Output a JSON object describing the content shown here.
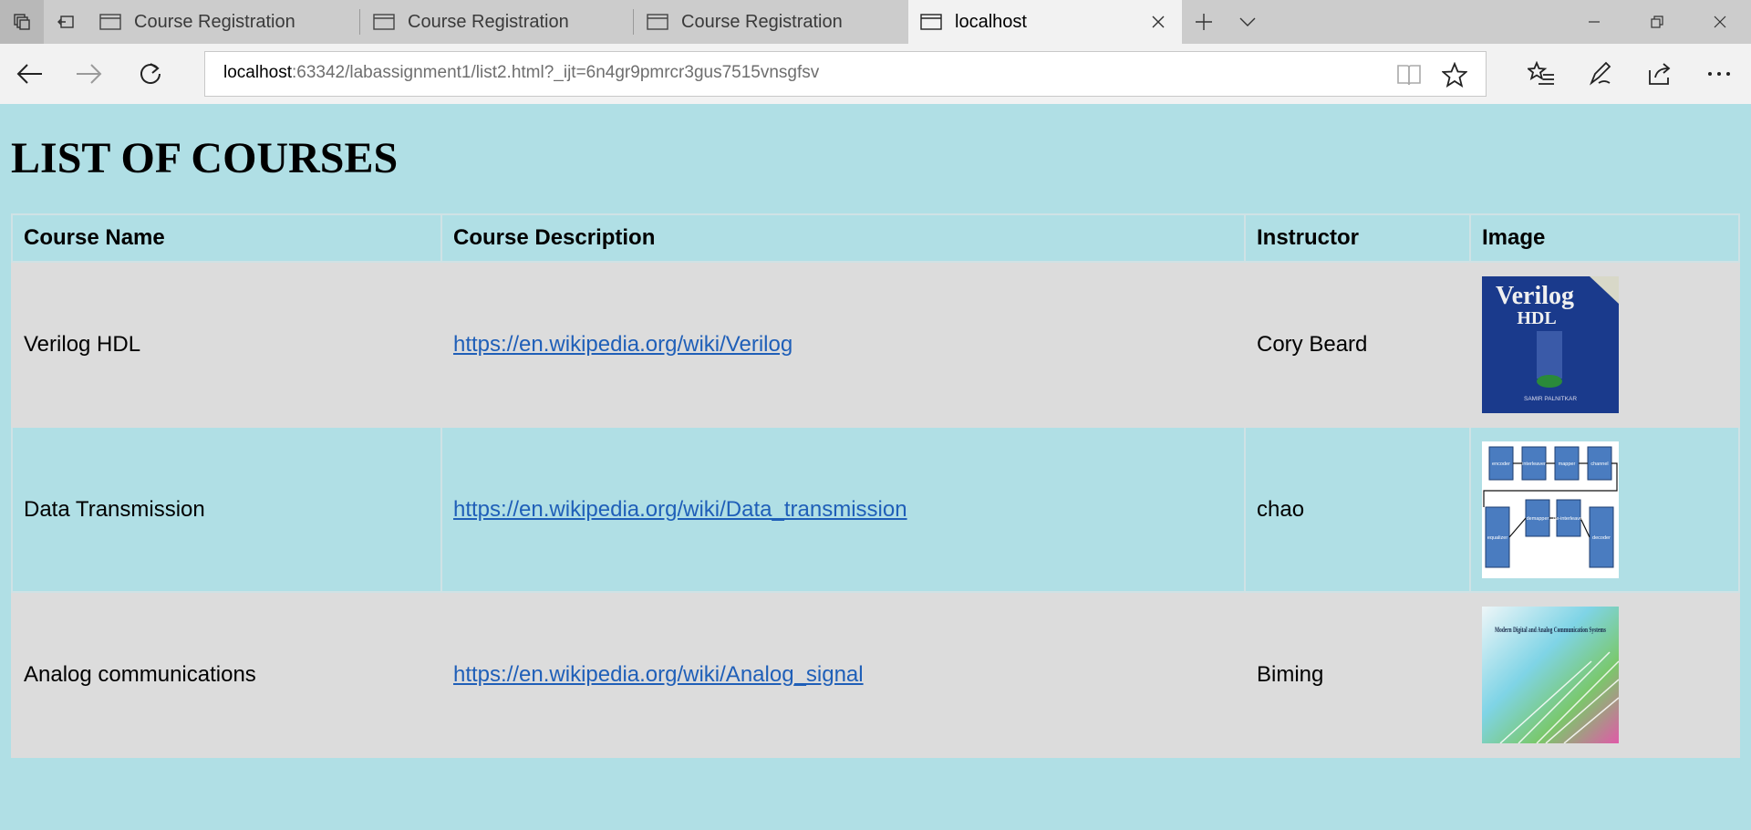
{
  "browser": {
    "tabs": [
      {
        "label": "Course Registration"
      },
      {
        "label": "Course Registration"
      },
      {
        "label": "Course Registration"
      },
      {
        "label": "localhost"
      }
    ],
    "address": {
      "host": "localhost",
      "rest": ":63342/labassignment1/list2.html?_ijt=6n4gr9pmrcr3gus7515vnsgfsv"
    }
  },
  "page": {
    "title": "LIST OF COURSES",
    "columns": [
      "Course Name",
      "Course Description",
      "Instructor",
      "Image"
    ],
    "rows": [
      {
        "name": "Verilog HDL",
        "link": "https://en.wikipedia.org/wiki/Verilog",
        "instructor": "Cory Beard",
        "image": "verilog-book-cover",
        "image_text": {
          "title": "Verilog",
          "subtitle": "HDL",
          "author": "SAMIR PALNITKAR"
        }
      },
      {
        "name": "Data Transmission",
        "link": "https://en.wikipedia.org/wiki/Data_transmission",
        "instructor": "chao",
        "image": "block-diagram",
        "image_text": {
          "blocks": [
            "encoder",
            "interleaver",
            "mapper",
            "channel",
            "equalizer",
            "demapper",
            "de-interleaver",
            "decoder"
          ]
        }
      },
      {
        "name": "Analog communications",
        "link": "https://en.wikipedia.org/wiki/Analog_signal",
        "instructor": "Biming",
        "image": "analog-book-cover",
        "image_text": {
          "title": "Modern Digital and Analog Communication Systems"
        }
      }
    ]
  },
  "colors": {
    "page_bg": "#b0dfe5",
    "row_alt_bg": "#dcdcdc",
    "link": "#1f5fb8"
  }
}
